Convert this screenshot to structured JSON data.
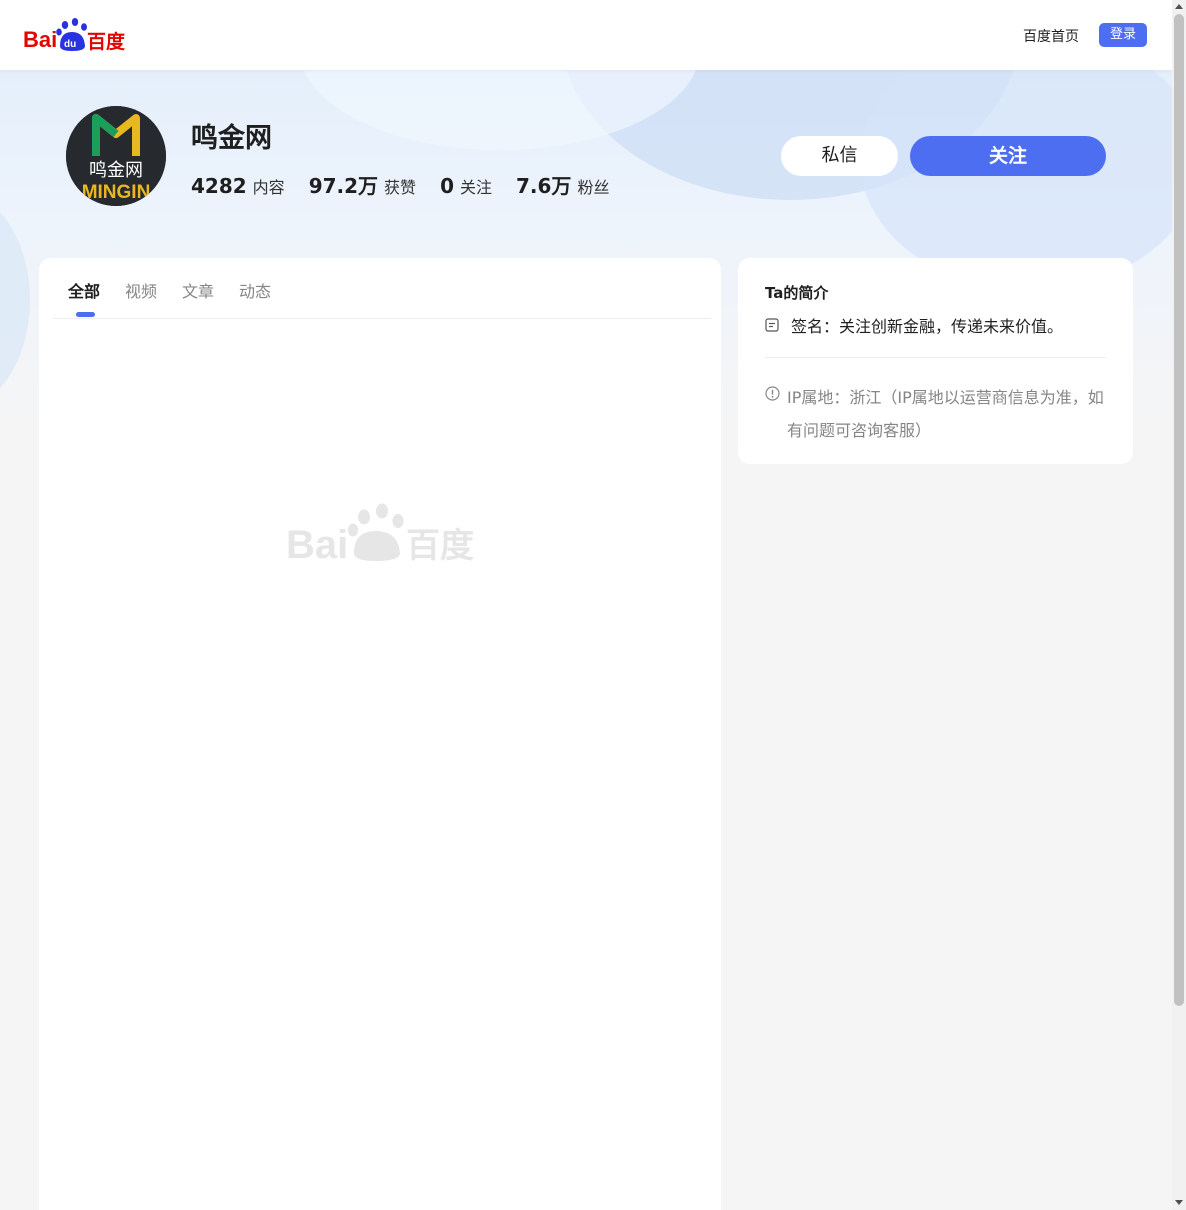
{
  "header": {
    "logo_text": "Bai百度",
    "nav_home": "百度首页",
    "login_label": "登录"
  },
  "profile": {
    "avatar_text": "鸣金网",
    "avatar_brand": "MINGIN",
    "name": "鸣金网",
    "stats": [
      {
        "value": "4282",
        "label": "内容"
      },
      {
        "value": "97.2万",
        "label": "获赞"
      },
      {
        "value": "0",
        "label": "关注"
      },
      {
        "value": "7.6万",
        "label": "粉丝"
      }
    ],
    "message_label": "私信",
    "follow_label": "关注"
  },
  "tabs": [
    {
      "label": "全部",
      "active": true
    },
    {
      "label": "视频",
      "active": false
    },
    {
      "label": "文章",
      "active": false
    },
    {
      "label": "动态",
      "active": false
    }
  ],
  "intro": {
    "title": "Ta的简介",
    "signature": "签名：关注创新金融，传递未来价值。",
    "ip_location": "IP属地：浙江（IP属地以运营商信息为准，如有问题可咨询客服）"
  },
  "colors": {
    "accent": "#4e6ef2",
    "logo_red": "#e10602",
    "logo_blue": "#2932e1"
  }
}
